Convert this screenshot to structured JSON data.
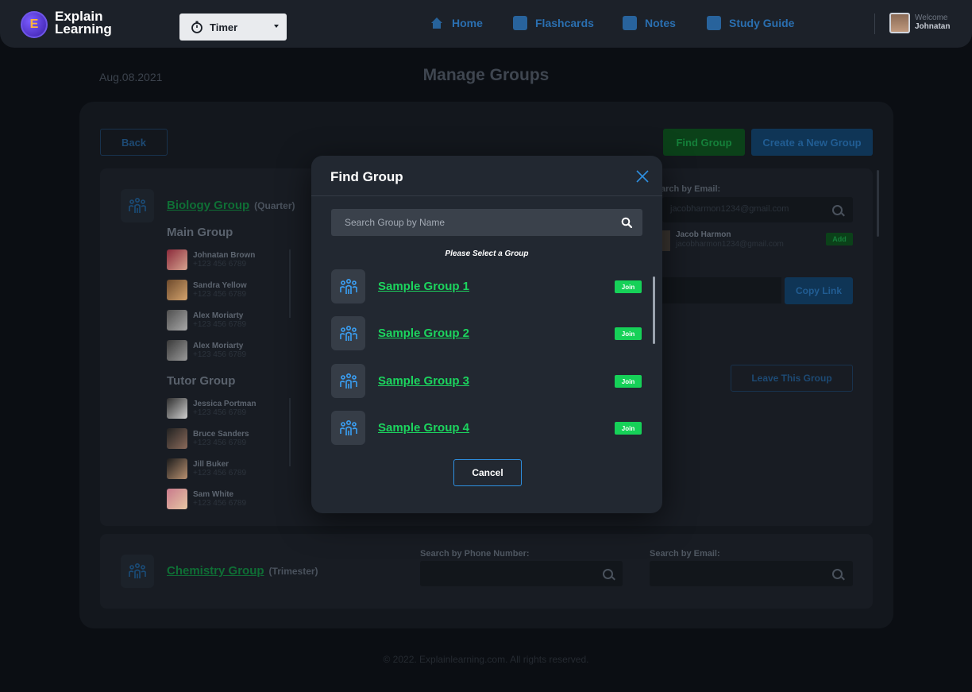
{
  "brand": {
    "line1": "Explain",
    "line2": "Learning",
    "logo_letter": "E"
  },
  "timer": {
    "label": "Timer"
  },
  "nav": [
    {
      "label": "Home",
      "icon": "home-icon"
    },
    {
      "label": "Flashcards",
      "icon": "flashcards-icon"
    },
    {
      "label": "Notes",
      "icon": "notes-icon"
    },
    {
      "label": "Study Guide",
      "icon": "study-guide-icon"
    }
  ],
  "user": {
    "welcome": "Welcome",
    "name": "Johnatan"
  },
  "header": {
    "date": "Aug.08.2021",
    "title": "Manage Groups"
  },
  "actions": {
    "back": "Back",
    "find_group": "Find Group",
    "create_group": "Create a New Group"
  },
  "group1": {
    "name": "Biology Group",
    "term": "(Quarter)",
    "main_section": "Main Group",
    "main_members": [
      {
        "name": "Johnatan Brown",
        "phone": "+123 456 6789"
      },
      {
        "name": "Sandra Yellow",
        "phone": "+123 456 6789"
      },
      {
        "name": "Alex Moriarty",
        "phone": "+123 456 6789"
      },
      {
        "name": "Alex Moriarty",
        "phone": "+123 456 6789"
      }
    ],
    "tutor_section": "Tutor Group",
    "tutor_members": [
      {
        "name": "Jessica Portman",
        "phone": "+123 456 6789"
      },
      {
        "name": "Bruce Sanders",
        "phone": "+123 456 6789"
      },
      {
        "name": "Jill Buker",
        "phone": "+123 456 6789"
      },
      {
        "name": "Sam White",
        "phone": "+123 456 6789"
      }
    ],
    "search_email_label": "arch by Email:",
    "search_email_value": "jacobharmon1234@gmail.com",
    "result_name": "Jacob Harmon",
    "result_email": "jacobharmon1234@gmail.com",
    "add_label": "Add",
    "copy_link": "Copy Link",
    "leave": "Leave This Group"
  },
  "group2": {
    "name": "Chemistry Group",
    "term": "(Trimester)",
    "search_phone_label": "Search by Phone Number:",
    "search_email_label": "Search by Email:"
  },
  "footer": "© 2022. Explainlearning.com. All rights reserved.",
  "modal": {
    "title": "Find Group",
    "search_placeholder": "Search Group by Name",
    "hint": "Please Select a Group",
    "groups": [
      {
        "name": "Sample Group 1",
        "join": "Join"
      },
      {
        "name": "Sample Group 2",
        "join": "Join"
      },
      {
        "name": "Sample Group 3",
        "join": "Join"
      },
      {
        "name": "Sample Group 4",
        "join": "Join"
      }
    ],
    "cancel": "Cancel"
  },
  "colors": {
    "accent_green": "#16d158",
    "accent_blue": "#2e8fe0",
    "modal_bg": "#222831",
    "page_bg": "#0b0e13"
  }
}
